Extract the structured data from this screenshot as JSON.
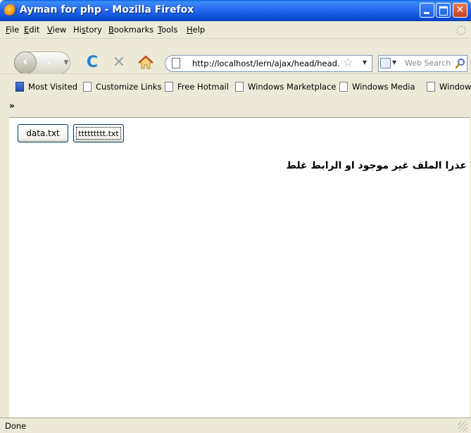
{
  "window": {
    "title": "Ayman for php - Mozilla Firefox",
    "icon": "firefox-icon"
  },
  "menu": {
    "items": [
      {
        "underline": "F",
        "rest": "ile"
      },
      {
        "underline": "E",
        "rest": "dit"
      },
      {
        "underline": "V",
        "rest": "iew"
      },
      {
        "pre": "Hi",
        "underline": "s",
        "rest": "tory"
      },
      {
        "underline": "B",
        "rest": "ookmarks"
      },
      {
        "underline": "T",
        "rest": "ools"
      },
      {
        "underline": "H",
        "rest": "elp"
      }
    ]
  },
  "navigation": {
    "url": "http://localhost/lern/ajax/head/head.",
    "search_placeholder": "Web Search"
  },
  "bookmarks": [
    {
      "label": "Most Visited",
      "icon": "most-visited-icon"
    },
    {
      "label": "Customize Links",
      "icon": "page-icon"
    },
    {
      "label": "Free Hotmail",
      "icon": "page-icon"
    },
    {
      "label": "Windows Marketplace",
      "icon": "page-icon"
    },
    {
      "label": "Windows Media",
      "icon": "page-icon"
    },
    {
      "label": "Windows",
      "icon": "page-icon"
    }
  ],
  "bookmarks_overflow": "»",
  "page": {
    "button_1": "data.txt",
    "button_2": "ttttttttt.txt",
    "message": "عذرا الملف غير موجود او الرابط غلط"
  },
  "status": {
    "text": "Done"
  },
  "colors": {
    "titlebar": "#0a4fd8",
    "chrome": "#ece9d8"
  }
}
